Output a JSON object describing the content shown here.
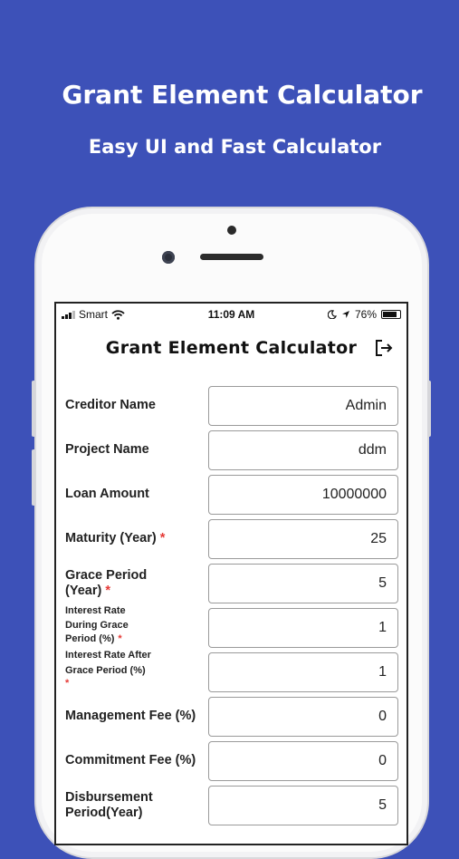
{
  "promo": {
    "title": "Grant Element Calculator",
    "subtitle": "Easy UI and Fast Calculator"
  },
  "status_bar": {
    "carrier": "Smart",
    "time": "11:09 AM",
    "battery": "76%"
  },
  "app": {
    "title": "Grant Element Calculator",
    "logout_icon": "logout-icon"
  },
  "form": {
    "fields": [
      {
        "label": "Creditor Name",
        "value": "Admin",
        "required": false
      },
      {
        "label": "Project Name",
        "value": "ddm",
        "required": false
      },
      {
        "label": "Loan Amount",
        "value": "10000000",
        "required": false
      },
      {
        "label": "Maturity (Year)",
        "value": "25",
        "required": true
      },
      {
        "label_line1": "Grace Period",
        "label_line2": "(Year)",
        "value": "5",
        "required": true
      },
      {
        "label_line1": "Interest Rate",
        "label_line2": "During Grace",
        "label_line3": "Period (%)",
        "value": "1",
        "required": true
      },
      {
        "label_line1": "Interest Rate After",
        "label_line2": "Grace Period (%)",
        "value": "1",
        "required": true
      },
      {
        "label": "Management Fee (%)",
        "value": "0",
        "required": false
      },
      {
        "label": "Commitment Fee (%)",
        "value": "0",
        "required": false
      },
      {
        "label_line1": "Disbursement",
        "label_line2": "Period(Year)",
        "value": "5",
        "required": false
      }
    ],
    "required_mark": "*"
  },
  "colors": {
    "background": "#3d51b8",
    "required": "#e53935"
  }
}
